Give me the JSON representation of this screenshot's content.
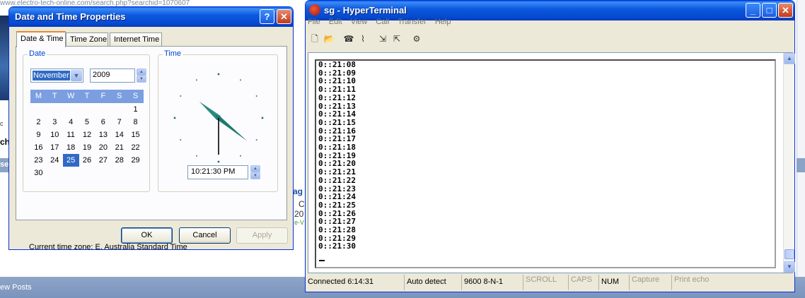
{
  "background": {
    "url_fragment": "www.electro-tech-online.com/search.php?searchid=1070607",
    "bottom_bar_text": "ew Posts",
    "fragments": [
      "ag",
      "C",
      "20",
      "e-V",
      "ch",
      "se",
      "c"
    ]
  },
  "dialog": {
    "title": "Date and Time Properties",
    "help_button": "?",
    "close_button": "✕",
    "tabs": [
      "Date & Time",
      "Time Zone",
      "Internet Time"
    ],
    "date_group_label": "Date",
    "month": "November",
    "year": "2009",
    "weekday_headers": [
      "M",
      "T",
      "W",
      "T",
      "F",
      "S",
      "S"
    ],
    "calendar_days": [
      "",
      "",
      "",
      "",
      "",
      "",
      "1",
      "2",
      "3",
      "4",
      "5",
      "6",
      "7",
      "8",
      "9",
      "10",
      "11",
      "12",
      "13",
      "14",
      "15",
      "16",
      "17",
      "18",
      "19",
      "20",
      "21",
      "22",
      "23",
      "24",
      "25",
      "26",
      "27",
      "28",
      "29",
      "30"
    ],
    "selected_day": "25",
    "time_group_label": "Time",
    "time_value": "10:21:30 PM",
    "clock": {
      "hour": 10,
      "minute": 21,
      "second": 30
    },
    "timezone_label": "Current time zone:",
    "timezone_value": "E. Australia Standard Time",
    "ok_label": "OK",
    "cancel_label": "Cancel",
    "apply_label": "Apply"
  },
  "hyperterminal": {
    "title": "sg - HyperTerminal",
    "menu": [
      "File",
      "Edit",
      "View",
      "Call",
      "Transfer",
      "Help"
    ],
    "toolbar_icons": [
      "new-icon",
      "open-icon",
      "disconnect-icon",
      "phone-icon",
      "send-icon",
      "receive-icon",
      "properties-icon"
    ],
    "lines": [
      "0::21:08",
      "0::21:09",
      "0::21:10",
      "0::21:11",
      "0::21:12",
      "0::21:13",
      "0::21:14",
      "0::21:15",
      "0::21:16",
      "0::21:17",
      "0::21:18",
      "0::21:19",
      "0::21:20",
      "0::21:21",
      "0::21:22",
      "0::21:23",
      "0::21:24",
      "0::21:25",
      "0::21:26",
      "0::21:27",
      "0::21:28",
      "0::21:29",
      "0::21:30"
    ],
    "status": {
      "connected": "Connected 6:14:31",
      "detect": "Auto detect",
      "settings": "9600 8-N-1",
      "scroll": "SCROLL",
      "caps": "CAPS",
      "num": "NUM",
      "capture": "Capture",
      "print_echo": "Print echo"
    }
  },
  "colors": {
    "xp_title_blue": "#0d5ae0",
    "selection_blue": "#316ac5",
    "clock_hand": "#2a8a80",
    "tab_accent": "#e68b2c"
  }
}
